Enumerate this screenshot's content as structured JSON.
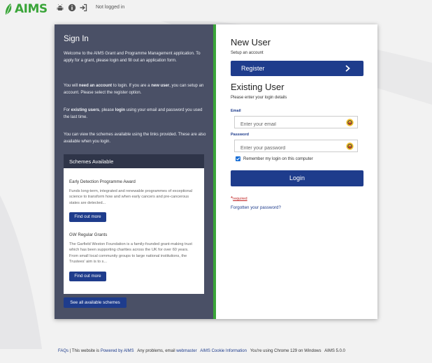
{
  "header": {
    "logo_text": "AIMS",
    "login_status": "Not logged in",
    "icons": [
      "android-icon",
      "info-icon",
      "sign-in-icon"
    ]
  },
  "sign_in_panel": {
    "title": "Sign In",
    "para1": "Welcome to the AIMS Grant and Programme Management application. To apply for a grant, please login and fill out an application form.",
    "para2_prefix": "You will ",
    "para2_bold1": "need an account",
    "para2_mid": " to login. If you are a ",
    "para2_bold2": "new user",
    "para2_suffix": ", you can setup an account. Please select the register option.",
    "para3_prefix": "For ",
    "para3_bold1": "existing users",
    "para3_mid": ", please ",
    "para3_bold2": "login",
    "para3_suffix": " using your email and password you used the last time.",
    "para4": "You can view the schemes available using the links provided. These are also available when you login.",
    "schemes": {
      "header": "Schemes Available",
      "items": [
        {
          "title": "Early Detection Programme Award",
          "description": "Funds long-term, integrated and renewable programmes of exceptional science to transform how and when early cancers and pre-cancerous states are detected...",
          "button": "Find out more"
        },
        {
          "title": "GW Regular Grants",
          "description": "The Garfield Weston Foundation is a family-founded grant-making trust which has been supporting charities across the UK for over 60 years. From small local community groups to large national institutions, the Trustees' aim is to s...",
          "button": "Find out more"
        }
      ],
      "see_all": "See all available schemes"
    }
  },
  "new_user": {
    "title": "New User",
    "subtitle": "Setup an account",
    "register_label": "Register"
  },
  "existing_user": {
    "title": "Existing User",
    "subtitle": "Please enter your login details",
    "email_label": "Email",
    "email_placeholder": "Enter your email",
    "email_value": "",
    "password_label": "Password",
    "password_placeholder": "Enter your password",
    "password_value": "",
    "remember_label": "Remember my login on this computer",
    "remember_checked": true,
    "login_label": "Login",
    "required_star": "*",
    "required_label": "required",
    "forgot_label": "Forgotten your password?"
  },
  "footer": {
    "faqs": "FAQs",
    "sep": " | This website is ",
    "powered": "Powered by AIMS",
    "problems": "Any problems, email ",
    "webmaster": "webmaster",
    "cookie": "AIMS Cookie Information",
    "browser": "You're using Chrome 129 on Windows",
    "version": "AIMS 5.0.0"
  },
  "colors": {
    "brand_green": "#3aa539",
    "panel_dark": "#4a5066",
    "button_blue": "#1e3c8c"
  }
}
